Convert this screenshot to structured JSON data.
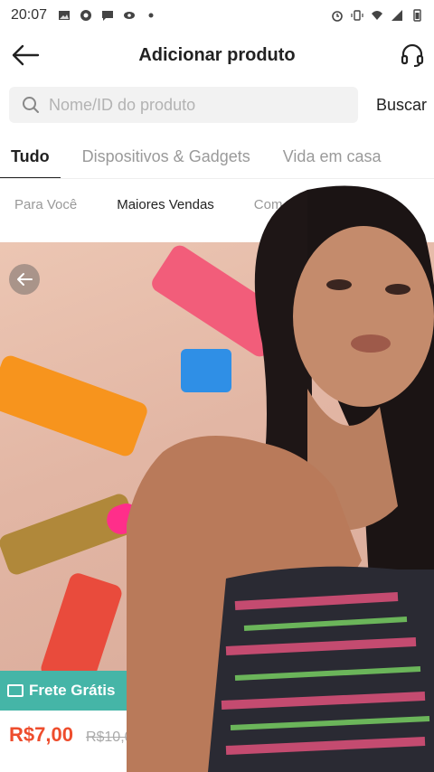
{
  "status_bar": {
    "time": "20:07",
    "left_icons": [
      "image-icon",
      "settings-gear-icon",
      "chat-bubble-icon",
      "eye-icon",
      "dot-icon"
    ],
    "right_icons": [
      "alarm-icon",
      "vibrate-icon",
      "wifi-icon",
      "signal-icon",
      "battery-icon"
    ]
  },
  "header": {
    "title": "Adicionar produto",
    "back_icon": "arrow-left-icon",
    "support_icon": "headset-icon"
  },
  "search": {
    "placeholder": "Nome/ID do produto",
    "button_label": "Buscar"
  },
  "category_tabs": [
    {
      "label": "Tudo",
      "active": true
    },
    {
      "label": "Dispositivos & Gadgets",
      "active": false
    },
    {
      "label": "Vida em casa",
      "active": false
    }
  ],
  "sub_tabs": [
    {
      "label": "Para Você",
      "active": false
    },
    {
      "label": "Maiores Vendas",
      "active": true
    },
    {
      "label": "Com",
      "active": false
    }
  ],
  "product": {
    "badge": "Frete Grátis",
    "price": "R$7,00",
    "old_price": "R$10,0"
  },
  "colors": {
    "accent_price": "#ee4d2d",
    "free_shipping": "#45b5a7"
  }
}
